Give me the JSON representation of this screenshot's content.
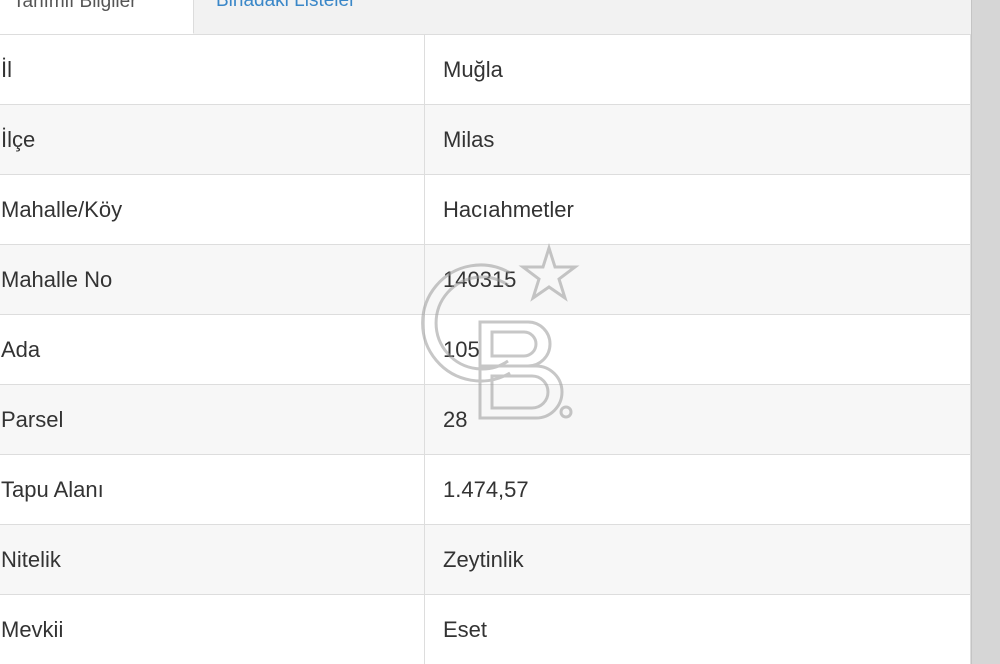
{
  "tabs": {
    "active_label": "Tanımlı Bilgiler",
    "inactive_label": "Binadaki Listeler"
  },
  "rows": [
    {
      "label": "İl",
      "value": "Muğla"
    },
    {
      "label": "İlçe",
      "value": "Milas"
    },
    {
      "label": "Mahalle/Köy",
      "value": "Hacıahmetler"
    },
    {
      "label": "Mahalle No",
      "value": "140315"
    },
    {
      "label": "Ada",
      "value": "105"
    },
    {
      "label": "Parsel",
      "value": "28"
    },
    {
      "label": "Tapu Alanı",
      "value": "1.474,57"
    },
    {
      "label": "Nitelik",
      "value": "Zeytinlik"
    },
    {
      "label": "Mevkii",
      "value": "Eset"
    }
  ],
  "watermark": {
    "icon": "cb-star-logo-icon",
    "color": "#9a9a9a"
  },
  "colors": {
    "tab_link": "#3a87c8",
    "text": "#333333",
    "row_stripe": "#f7f7f7",
    "border": "#dddddd"
  }
}
